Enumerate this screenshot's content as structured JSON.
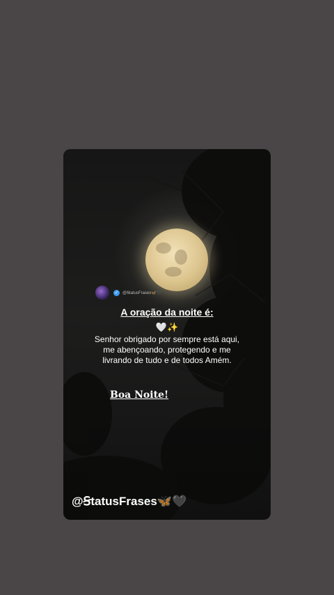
{
  "post": {
    "small_handle": "@ꞨtatusFrases🦋🖤",
    "title": "A oração da noite é:",
    "emoji_line": "🤍✨",
    "body": "Senhor obrigado por sempre está aqui, me abençoando, protegendo e me livrando de tudo e de todos Amém.",
    "goodnight": "Boa Noite!",
    "footer_handle": "@ꞨtatusFrases🦋🖤"
  },
  "icons": {
    "verified": "verified-badge-icon",
    "avatar": "profile-avatar"
  },
  "colors": {
    "page_background": "#4a4647",
    "verified_badge": "#3d9bf0",
    "moon": "#e8d4a2"
  }
}
